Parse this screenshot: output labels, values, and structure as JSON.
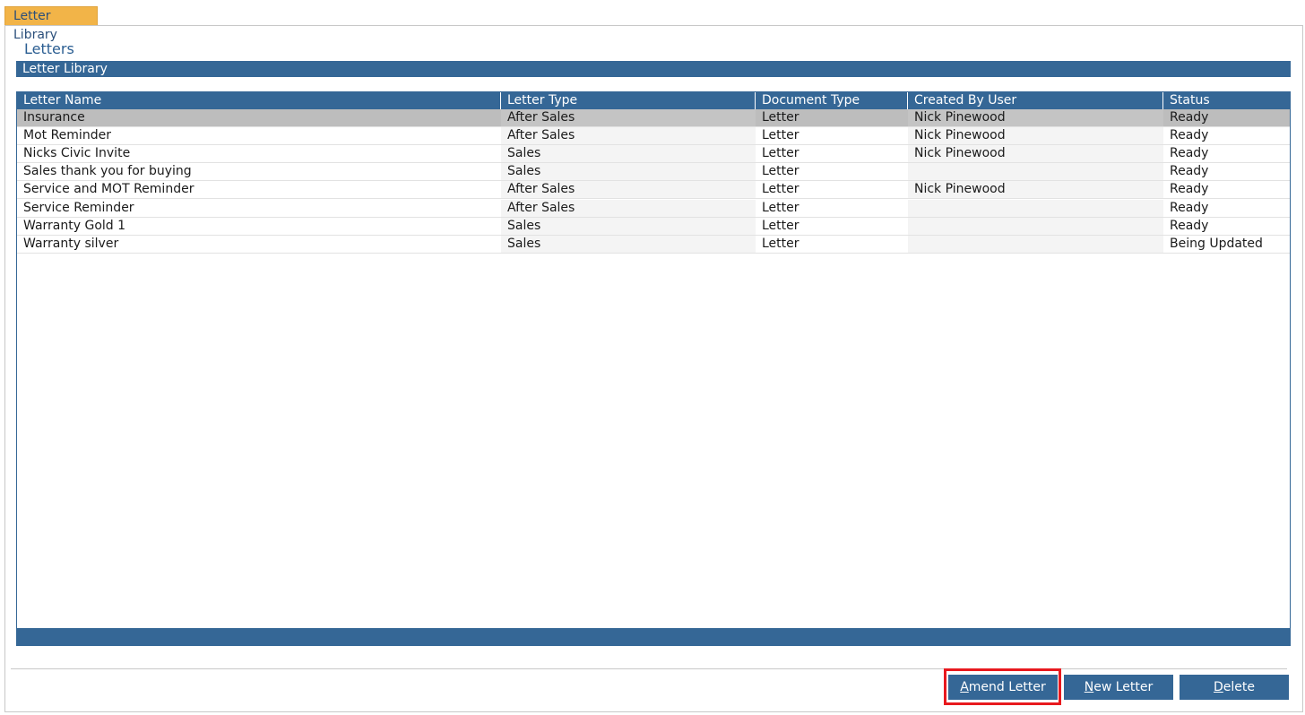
{
  "tab": {
    "label": "Letter Library"
  },
  "page": {
    "title": "Letters",
    "section_label": "Letter Library"
  },
  "table": {
    "columns": [
      "Letter Name",
      "Letter Type",
      "Document Type",
      "Created By User",
      "Status"
    ],
    "rows": [
      {
        "name": "Insurance",
        "letter_type": "After Sales",
        "document_type": "Letter",
        "created_by": "Nick Pinewood",
        "status": "Ready",
        "selected": true
      },
      {
        "name": "Mot Reminder",
        "letter_type": "After Sales",
        "document_type": "Letter",
        "created_by": "Nick Pinewood",
        "status": "Ready"
      },
      {
        "name": "Nicks Civic Invite",
        "letter_type": "Sales",
        "document_type": "Letter",
        "created_by": "Nick Pinewood",
        "status": "Ready"
      },
      {
        "name": "Sales thank you for buying",
        "letter_type": "Sales",
        "document_type": "Letter",
        "created_by": "",
        "status": "Ready"
      },
      {
        "name": "Service and MOT Reminder",
        "letter_type": "After Sales",
        "document_type": "Letter",
        "created_by": "Nick Pinewood",
        "status": "Ready"
      },
      {
        "name": "Service Reminder",
        "letter_type": "After Sales",
        "document_type": "Letter",
        "created_by": "",
        "status": "Ready"
      },
      {
        "name": "Warranty Gold 1",
        "letter_type": "Sales",
        "document_type": "Letter",
        "created_by": "",
        "status": "Ready"
      },
      {
        "name": "Warranty silver",
        "letter_type": "Sales",
        "document_type": "Letter",
        "created_by": "",
        "status": "Being Updated"
      }
    ]
  },
  "buttons": {
    "amend": {
      "mnemonic": "A",
      "rest": "mend Letter"
    },
    "new": {
      "mnemonic": "N",
      "rest": "ew Letter"
    },
    "delete": {
      "mnemonic": "D",
      "rest": "elete"
    }
  },
  "colors": {
    "brand_blue": "#356796",
    "tab_orange": "#f2b448",
    "highlight_red": "#e8191e",
    "selected_row": "#bdbdbd"
  }
}
